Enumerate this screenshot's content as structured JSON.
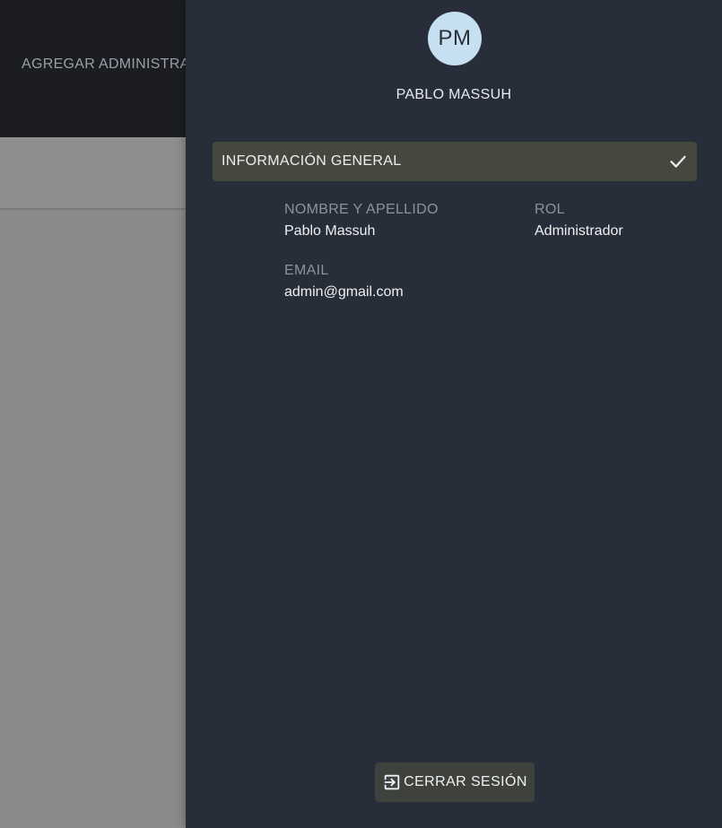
{
  "background": {
    "header_label": "AGREGAR ADMINISTRA"
  },
  "drawer": {
    "avatar_initials": "PM",
    "user_name": "PABLO MASSUH",
    "section": {
      "title": "INFORMACIÓN GENERAL",
      "icon": "check-icon"
    },
    "fields": {
      "name_label": "NOMBRE Y APELLIDO",
      "name_value": "Pablo Massuh",
      "role_label": "ROL",
      "role_value": "Administrador",
      "email_label": "EMAIL",
      "email_value": "admin@gmail.com"
    },
    "logout": {
      "label": "CERRAR SESIÓN",
      "icon": "logout-icon"
    }
  },
  "colors": {
    "drawer_bg": "#282e39",
    "avatar_bg": "#c6e0f2",
    "section_bg": "#45483f",
    "overlay_bg": "#8a8a8a"
  }
}
